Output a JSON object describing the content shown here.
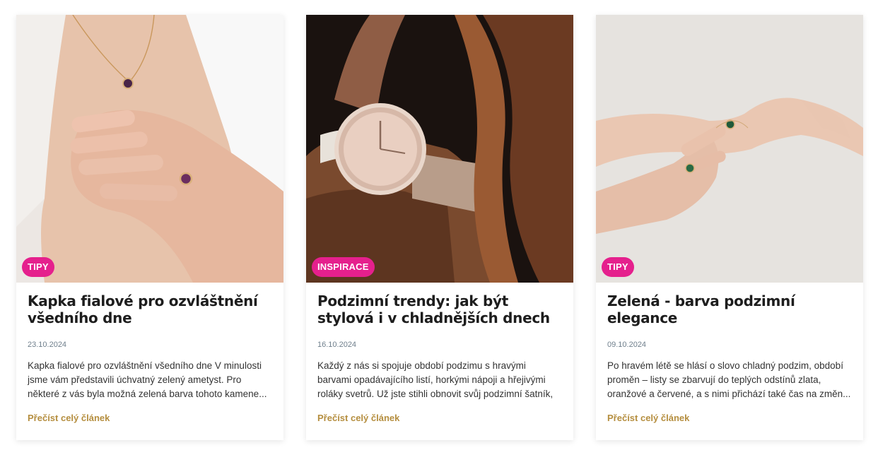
{
  "cards": [
    {
      "badge": "TIPY",
      "title": "Kapka fialové pro ozvláštnění všedního dne",
      "date": "23.10.2024",
      "excerpt": "Kapka fialové pro ozvláštnění všedního dne V minulosti jsme vám představili úchvatný zelený ametyst. Pro některé z vás byla možná zelená barva tohoto kamene...",
      "link": "Přečíst celý článek"
    },
    {
      "badge": "INSPIRACE",
      "title": "Podzimní trendy: jak být stylová i v chladnějších dnech",
      "date": "16.10.2024",
      "excerpt": "Každý z nás si spojuje období podzimu s hravými barvami opadávajícího listí, horkými nápoji a hřejivými roláky svetrů. Už jste stihli obnovit svůj podzimní šatník, či...",
      "link": "Přečíst celý článek"
    },
    {
      "badge": "TIPY",
      "title": "Zelená - barva podzimní elegance",
      "date": "09.10.2024",
      "excerpt": "Po hravém létě se hlásí o slovo chladný podzim, období proměn – listy se zbarvují do teplých odstínů zlata, oranžové a červené, a s nimi přichází také čas na změn...",
      "link": "Přečíst celý článek"
    }
  ],
  "colors": {
    "badge": "#e5208d",
    "link": "#b58e3f",
    "title": "#1d1d1d",
    "date": "#6f7f8c"
  }
}
